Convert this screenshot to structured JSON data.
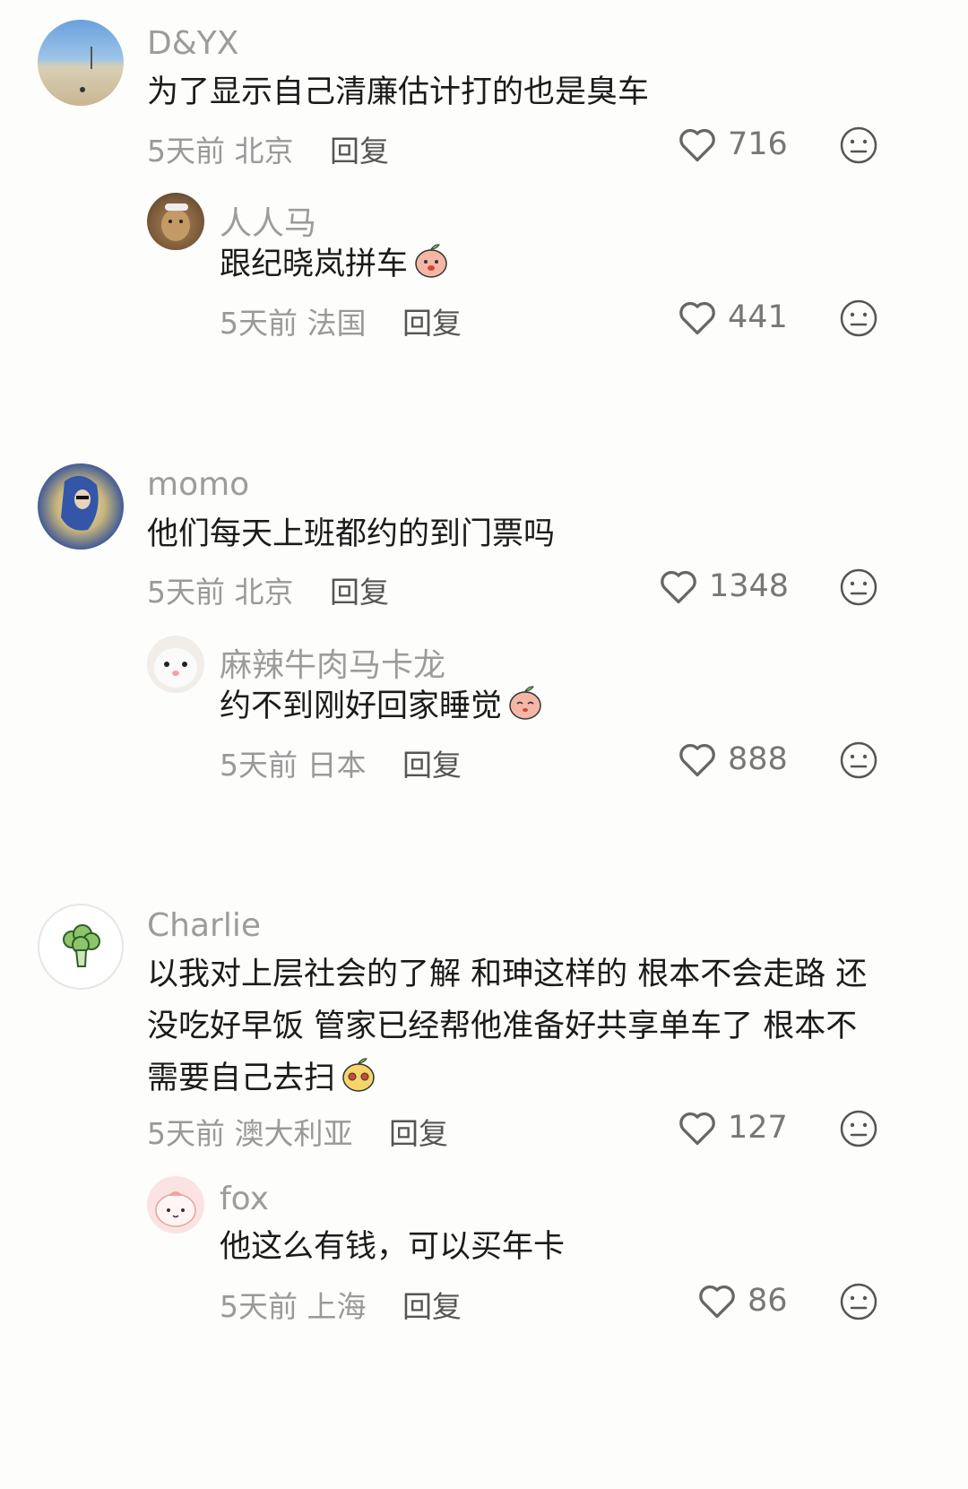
{
  "comments": [
    {
      "username": "D&YX",
      "text": "为了显示自己清廉估计打的也是臭车",
      "time": "5天前",
      "location": "北京",
      "reply_label": "回复",
      "likes": "716",
      "replies": [
        {
          "username": "人人马",
          "text": "跟纪晓岚拼车",
          "time": "5天前",
          "location": "法国",
          "reply_label": "回复",
          "likes": "441"
        }
      ]
    },
    {
      "username": "momo",
      "text": "他们每天上班都约的到门票吗",
      "time": "5天前",
      "location": "北京",
      "reply_label": "回复",
      "likes": "1348",
      "replies": [
        {
          "username": "麻辣牛肉马卡龙",
          "text": "约不到刚好回家睡觉",
          "time": "5天前",
          "location": "日本",
          "reply_label": "回复",
          "likes": "888"
        }
      ]
    },
    {
      "username": "Charlie",
      "text_lines": [
        "以我对上层社会的了解 和珅这样的 根本不会走路 还",
        "没吃好早饭 管家已经帮他准备好共享单车了 根本不",
        "需要自己去扫"
      ],
      "time": "5天前",
      "location": "澳大利亚",
      "reply_label": "回复",
      "likes": "127",
      "replies": [
        {
          "username": "fox",
          "text": "他这么有钱，可以买年卡",
          "time": "5天前",
          "location": "上海",
          "reply_label": "回复",
          "likes": "86"
        }
      ]
    }
  ],
  "icons": {
    "like": "heart-outline-icon",
    "dislike": "neutral-face-icon",
    "emoji": "peach-emoji-icon"
  },
  "colors": {
    "background": "#fdfdfb",
    "username": "#9c9c9c",
    "meta": "#999999"
  }
}
